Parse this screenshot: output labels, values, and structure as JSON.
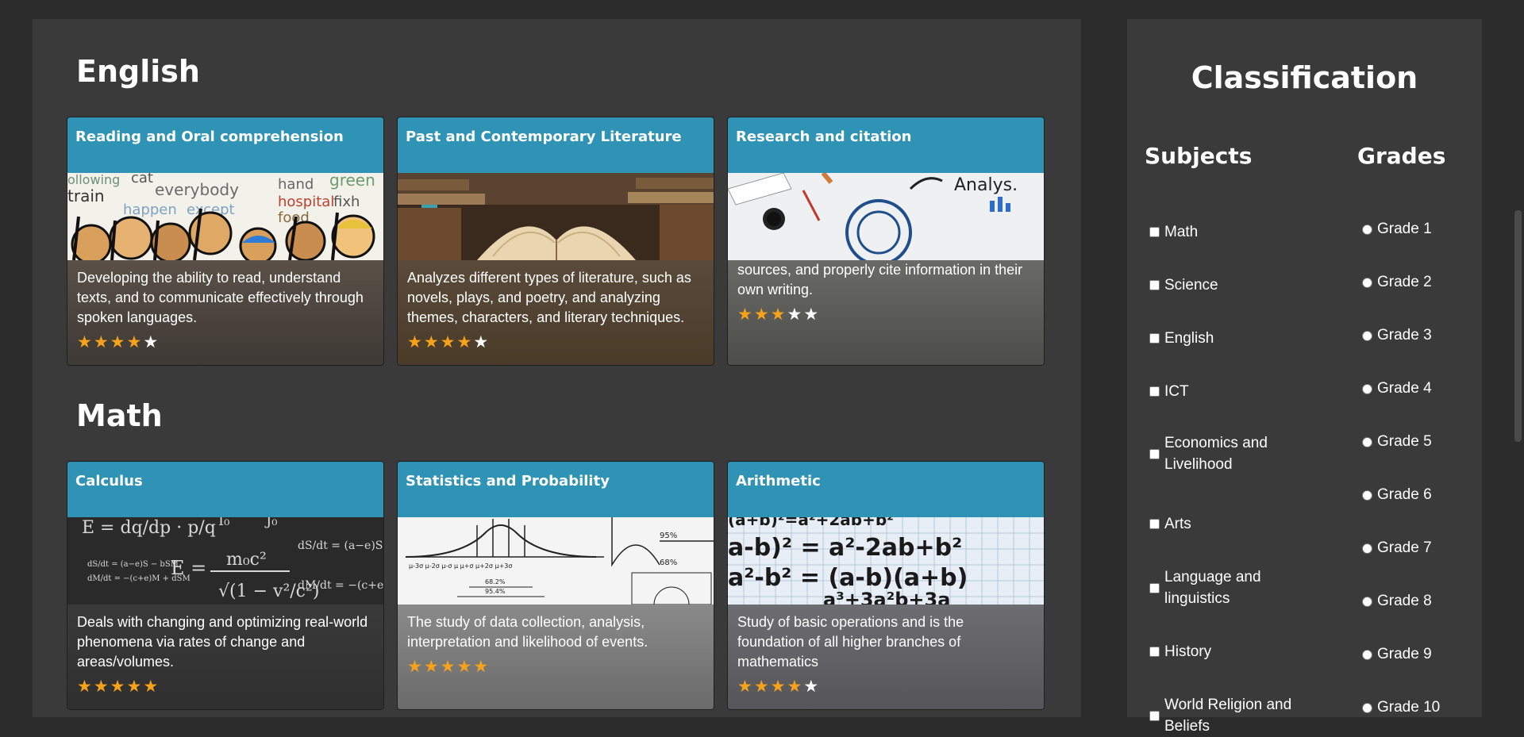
{
  "sections": [
    {
      "title": "English",
      "cards": [
        {
          "title": "Reading and Oral comprehension",
          "description": "Developing the ability to read, understand texts, and to communicate effectively through spoken languages.",
          "rating": 4,
          "image": "cartoon-crowd-image"
        },
        {
          "title": "Past and Contemporary Literature",
          "description": "Analyzes different types of literature, such as novels, plays, and poetry, and analyzing themes, characters, and literary techniques.",
          "rating": 4,
          "image": "open-book-image"
        },
        {
          "title": "Research and citation",
          "description": "sources, and properly cite information in their own writing.",
          "rating": 3,
          "image": "analysis-desk-image"
        }
      ]
    },
    {
      "title": "Math",
      "cards": [
        {
          "title": "Calculus",
          "description": "Deals with changing and optimizing real-world phenomena via rates of change and areas/volumes.",
          "rating": 5,
          "image": "equations-blackboard-image"
        },
        {
          "title": "Statistics and Probability",
          "description": "The study of data collection, analysis, interpretation and likelihood of events.",
          "rating": 5,
          "image": "normal-distribution-image"
        },
        {
          "title": "Arithmetic",
          "description": "Study of basic operations and is the foundation of all higher branches of mathematics",
          "rating": 4,
          "image": "algebra-notebook-image"
        }
      ]
    }
  ],
  "sidebar": {
    "title": "Classification",
    "subjects_heading": "Subjects",
    "grades_heading": "Grades",
    "subjects": [
      "Math",
      "Science",
      "English",
      "ICT",
      "Economics and Livelihood",
      "Arts",
      "Language and linguistics",
      "History",
      "World Religion and Beliefs"
    ],
    "grades": [
      "Grade 1",
      "Grade 2",
      "Grade 3",
      "Grade 4",
      "Grade 5",
      "Grade 6",
      "Grade 7",
      "Grade 8",
      "Grade 9",
      "Grade 10"
    ]
  },
  "colors": {
    "card_header": "#2e93b5",
    "star_filled": "#f7a21b",
    "star_empty": "#ffffff",
    "panel": "#3a3a3a",
    "page": "#2c2c2c"
  }
}
